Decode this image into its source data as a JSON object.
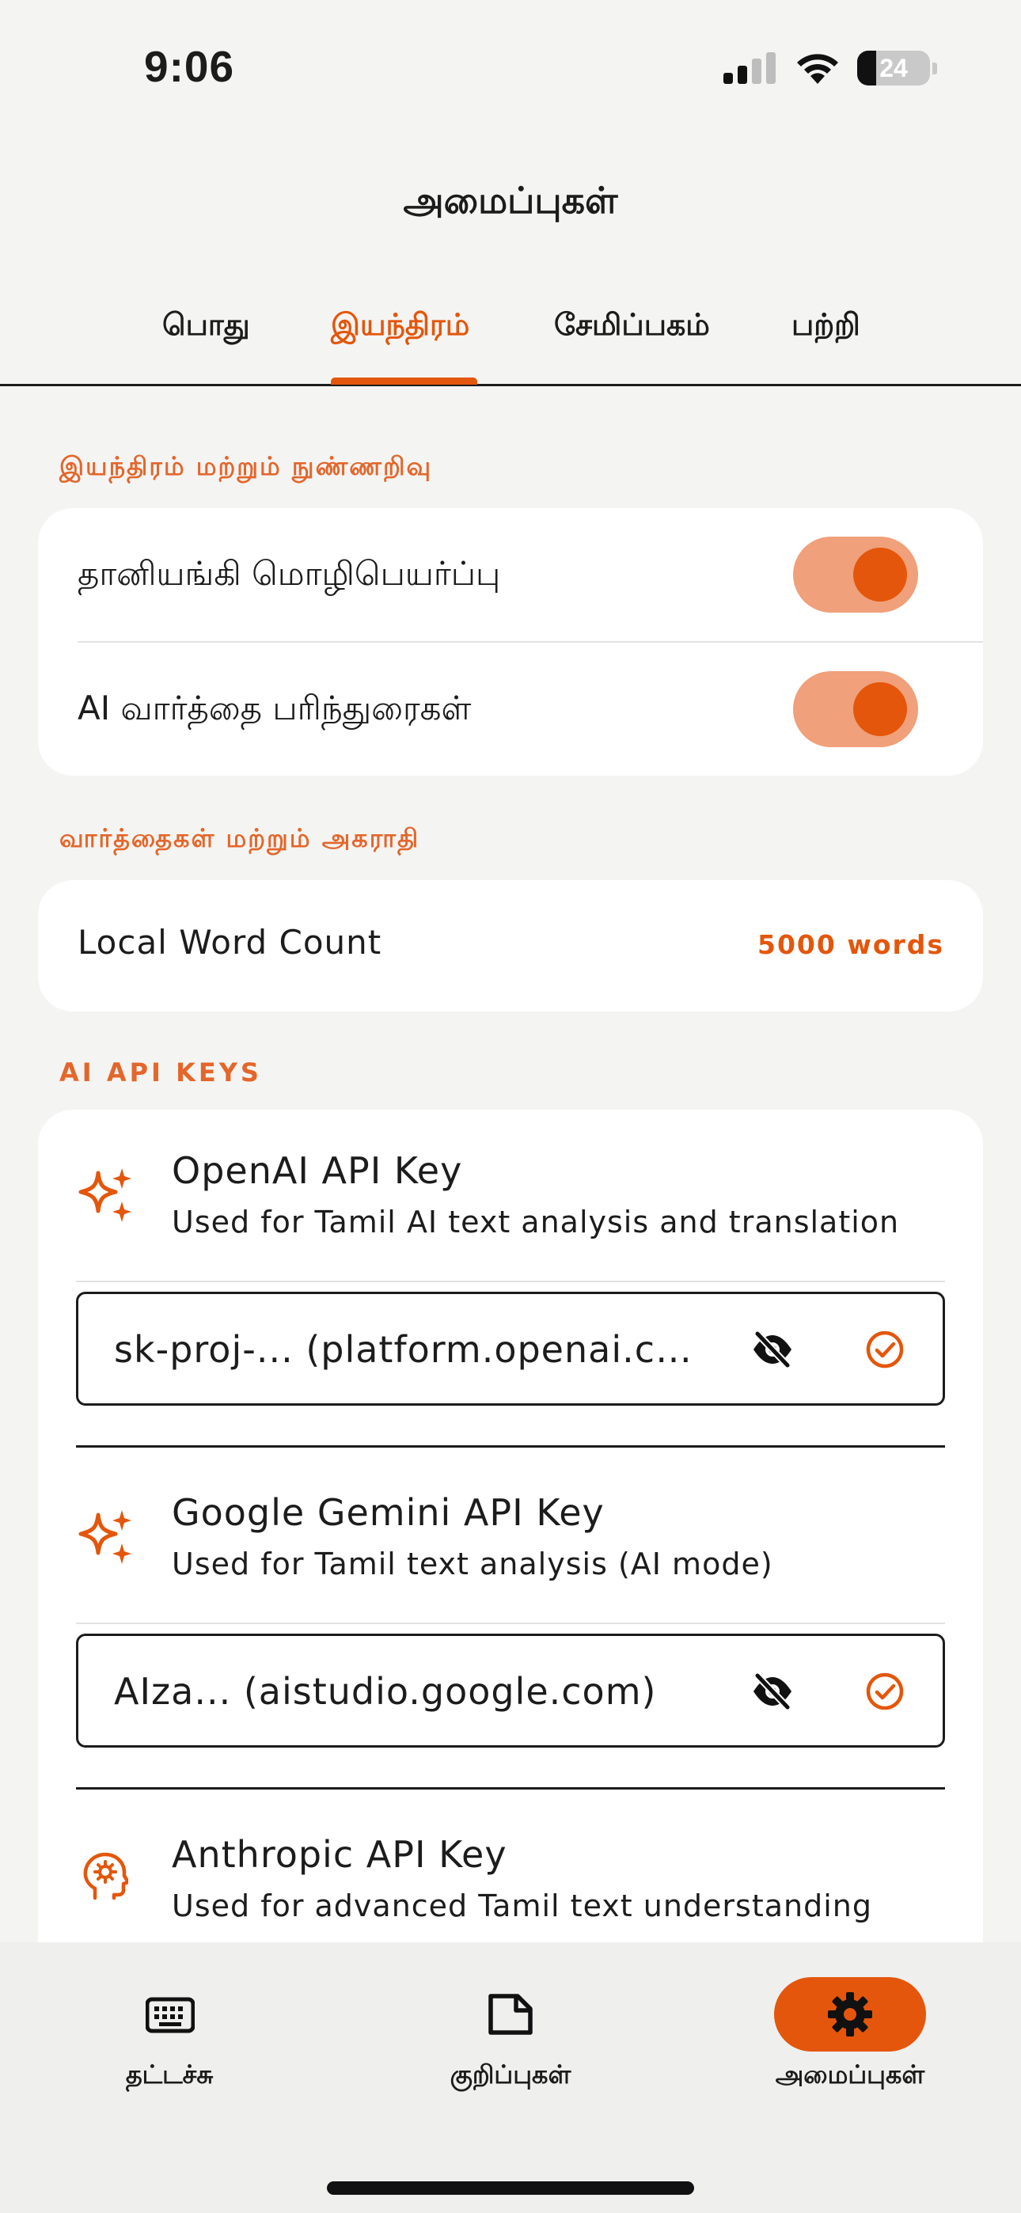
{
  "status_bar": {
    "time": "9:06",
    "battery": "24"
  },
  "header": {
    "title": "அமைப்புகள்"
  },
  "tabs": [
    {
      "label": "பொது"
    },
    {
      "label": "இயந்திரம்"
    },
    {
      "label": "சேமிப்பகம்"
    },
    {
      "label": "பற்றி"
    }
  ],
  "active_tab": "இயந்திரம்",
  "sections": {
    "engine_ai": {
      "label": "இயந்திரம் மற்றும் நுண்ணறிவு",
      "rows": [
        {
          "label": "தானியங்கி மொழிபெயர்ப்பு",
          "enabled": true
        },
        {
          "label": "AI வார்த்தை பரிந்துரைகள்",
          "enabled": true
        }
      ]
    },
    "words_dictionary": {
      "label": "வார்த்தைகள் மற்றும் அகராதி",
      "local_word_count_label": "Local Word Count",
      "local_word_count_value": "5000 words"
    },
    "api_keys": {
      "label": "AI API KEYS",
      "openai": {
        "title": "OpenAI API Key",
        "description": "Used for Tamil AI text analysis and translation",
        "value": "sk-proj-... (platform.openai.c…",
        "icon": "sparkle-icon"
      },
      "gemini": {
        "title": "Google Gemini API Key",
        "description": "Used for Tamil text analysis (AI mode)",
        "value": "AIza... (aistudio.google.com)",
        "icon": "sparkle-icon"
      },
      "anthropic": {
        "title": "Anthropic API Key",
        "description": "Used for advanced Tamil text understanding",
        "icon": "brain-head-icon"
      }
    }
  },
  "bottom_nav": [
    {
      "label": "தட்டச்சு",
      "icon": "keyboard-icon"
    },
    {
      "label": "குறிப்புகள்",
      "icon": "note-icon"
    },
    {
      "label": "அமைப்புகள்",
      "icon": "gear-icon",
      "active": true
    }
  ],
  "colors": {
    "accent": "#e4560b",
    "accent_light": "#f0a07a",
    "background": "#f4f4f3"
  }
}
